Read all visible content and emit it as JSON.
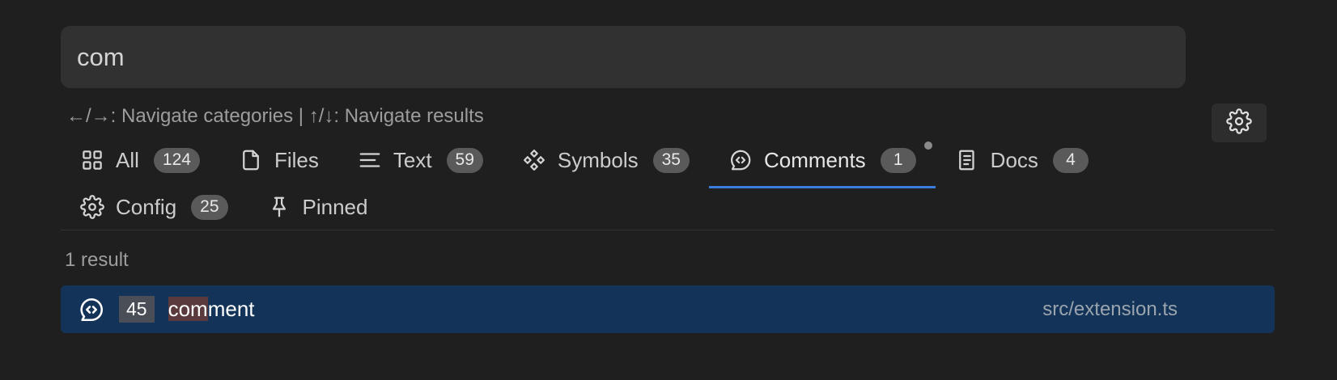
{
  "search": {
    "value": "com",
    "placeholder": ""
  },
  "hint": "←/→: Navigate categories | ↑/↓: Navigate results",
  "settings": {
    "icon": "gear-icon"
  },
  "tabs": [
    {
      "key": "all",
      "label": "All",
      "count": "124",
      "icon": "grid-icon",
      "active": false
    },
    {
      "key": "files",
      "label": "Files",
      "count": "",
      "icon": "file-icon",
      "active": false
    },
    {
      "key": "text",
      "label": "Text",
      "count": "59",
      "icon": "lines-icon",
      "active": false
    },
    {
      "key": "symbols",
      "label": "Symbols",
      "count": "35",
      "icon": "symbols-icon",
      "active": false
    },
    {
      "key": "comments",
      "label": "Comments",
      "count": "1",
      "icon": "comment-icon",
      "active": true
    },
    {
      "key": "docs",
      "label": "Docs",
      "count": "4",
      "icon": "book-icon",
      "active": false
    },
    {
      "key": "config",
      "label": "Config",
      "count": "25",
      "icon": "gear-icon",
      "active": false
    },
    {
      "key": "pinned",
      "label": "Pinned",
      "count": "",
      "icon": "pin-icon",
      "active": false
    }
  ],
  "results": {
    "count_text": "1 result",
    "items": [
      {
        "icon": "comment-icon",
        "line": "45",
        "match": "com",
        "rest": "ment",
        "path": "src/extension.ts"
      }
    ]
  },
  "colors": {
    "accent": "#3b7ddd",
    "selection": "#133458",
    "match_highlight": "#5a3a3c"
  }
}
